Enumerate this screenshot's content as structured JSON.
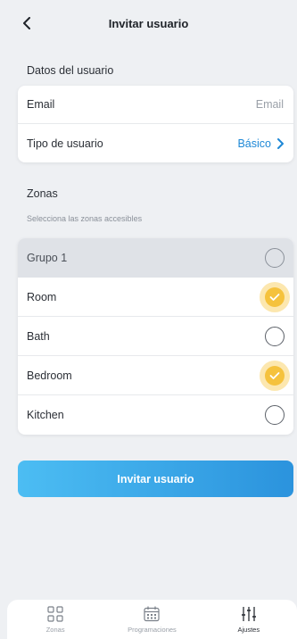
{
  "header": {
    "title": "Invitar usuario",
    "back_icon": "chevron-left-icon"
  },
  "user_data": {
    "section_title": "Datos del usuario",
    "email": {
      "label": "Email",
      "placeholder": "Email"
    },
    "user_type": {
      "label": "Tipo de usuario",
      "value": "Básico"
    }
  },
  "zones": {
    "section_title": "Zonas",
    "subtitle": "Selecciona las zonas accesibles",
    "group": {
      "label": "Grupo 1",
      "checked": false
    },
    "items": [
      {
        "label": "Room",
        "checked": true
      },
      {
        "label": "Bath",
        "checked": false
      },
      {
        "label": "Bedroom",
        "checked": true
      },
      {
        "label": "Kitchen",
        "checked": false
      }
    ]
  },
  "invite_button": {
    "label": "Invitar usuario"
  },
  "tabbar": {
    "tabs": [
      {
        "label": "Zonas",
        "icon": "grid-icon",
        "active": false
      },
      {
        "label": "Programaciones",
        "icon": "calendar-icon",
        "active": false
      },
      {
        "label": "Ajustes",
        "icon": "sliders-icon",
        "active": true
      }
    ]
  },
  "colors": {
    "accent": "#1e88d6",
    "check": "#f5c23d",
    "button_start": "#4cbdf3",
    "button_end": "#2b93dd",
    "background": "#eef0f3"
  }
}
